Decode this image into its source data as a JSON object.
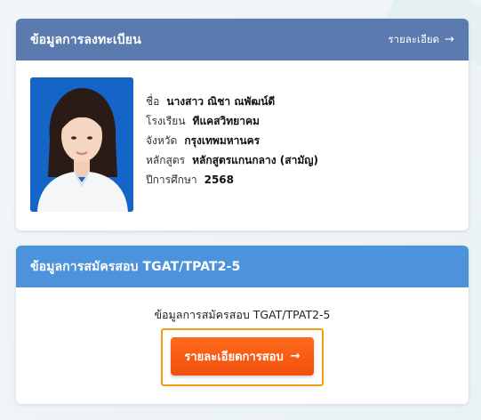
{
  "registration": {
    "title": "ข้อมูลการลงทะเบียน",
    "detail_link": "รายละเอียด",
    "arrow": "→",
    "fields": [
      {
        "label": "ชื่อ",
        "value": "นางสาว ณิชา ณพัฒน์ดี"
      },
      {
        "label": "โรงเรียน",
        "value": "ทีแคสวิทยาคม"
      },
      {
        "label": "จังหวัด",
        "value": "กรุงเทพมหานคร"
      },
      {
        "label": "หลักสูตร",
        "value": "หลักสูตรแกนกลาง (สามัญ)"
      },
      {
        "label": "ปีการศึกษา",
        "value": "2568"
      }
    ]
  },
  "exam": {
    "title": "ข้อมูลการสมัครสอบ TGAT/TPAT2-5",
    "body_text": "ข้อมูลการสมัครสอบ TGAT/TPAT2-5",
    "button_label": "รายละเอียดการสอบ",
    "arrow": "→"
  },
  "colors": {
    "registration_header": "#5b7bb0",
    "exam_header": "#4c93dc",
    "button": "#f0500c",
    "button_outline": "#f39c12"
  }
}
